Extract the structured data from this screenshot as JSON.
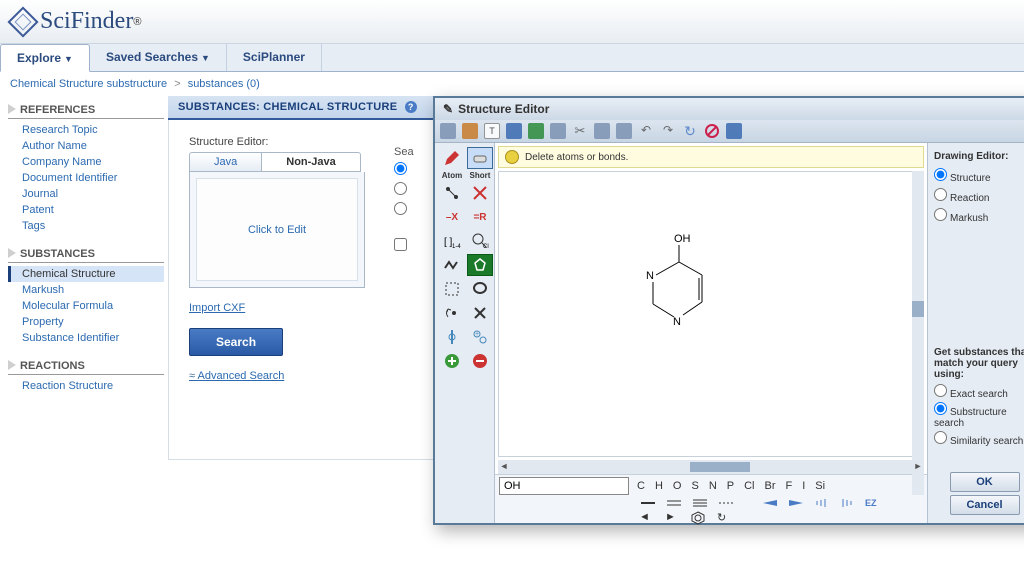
{
  "brand": "SciFinder",
  "nav": {
    "explore": "Explore",
    "saved": "Saved Searches",
    "sciplanner": "SciPlanner"
  },
  "breadcrumb": {
    "a": "Chemical Structure substructure",
    "b": "substances (0)"
  },
  "sidebar": {
    "references": {
      "heading": "REFERENCES",
      "items": [
        "Research Topic",
        "Author Name",
        "Company Name",
        "Document Identifier",
        "Journal",
        "Patent",
        "Tags"
      ]
    },
    "substances": {
      "heading": "SUBSTANCES",
      "items": [
        "Chemical Structure",
        "Markush",
        "Molecular Formula",
        "Property",
        "Substance Identifier"
      ]
    },
    "reactions": {
      "heading": "REACTIONS",
      "items": [
        "Reaction Structure"
      ]
    }
  },
  "panel": {
    "title": "SUBSTANCES: CHEMICAL STRUCTURE",
    "se_label": "Structure Editor:",
    "tab_java": "Java",
    "tab_nonjava": "Non-Java",
    "click_to_edit": "Click to Edit",
    "import": "Import CXF",
    "search": "Search",
    "advanced": "Advanced Search",
    "search_type_label": "Sea"
  },
  "modal": {
    "title": "Structure Editor",
    "hint": "Delete atoms or bonds.",
    "drawing_editor": "Drawing Editor:",
    "de_opts": [
      "Structure",
      "Reaction",
      "Markush"
    ],
    "match_label": "Get substances that match your query using:",
    "match_opts": [
      "Exact search",
      "Substructure search",
      "Similarity search"
    ],
    "atom_input": "OH",
    "atoms": [
      "C",
      "H",
      "O",
      "S",
      "N",
      "P",
      "Cl",
      "Br",
      "F",
      "I",
      "Si"
    ],
    "ok": "OK",
    "cancel": "Cancel",
    "palette_atom": "Atom",
    "palette_short": "Short",
    "molecule_labels": {
      "oh": "OH",
      "n1": "N",
      "n2": "N"
    }
  }
}
